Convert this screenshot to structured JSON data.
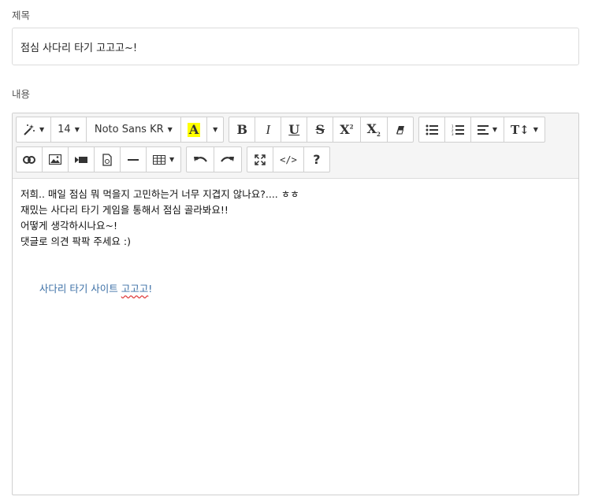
{
  "form": {
    "title_label": "제목",
    "title_value": "점심 사다리 타기 고고고~!",
    "content_label": "내용"
  },
  "toolbar": {
    "font_size": "14",
    "font_family": "Noto Sans KR",
    "color_letter": "A",
    "bold": "B",
    "italic": "I",
    "underline": "U",
    "strikethrough": "S",
    "superscript": "X",
    "subscript": "X",
    "help": "?",
    "highlight_color": "#ffff00"
  },
  "content": {
    "lines": [
      "저희.. 매일 점심 뭐 먹을지 고민하는거 너무 지겹지 않나요?.... ㅎㅎ",
      "재밌는 사다리 타기 게임을 통해서 점심 골라봐요!!",
      "어떻게 생각하시나요~!",
      "댓글로 의견 팍팍 주세요 :)"
    ],
    "link_prefix": "사다리 타기 사이트 ",
    "link_misspelled": "고고고",
    "link_suffix": "!",
    "link_color": "#3a6ea5"
  }
}
